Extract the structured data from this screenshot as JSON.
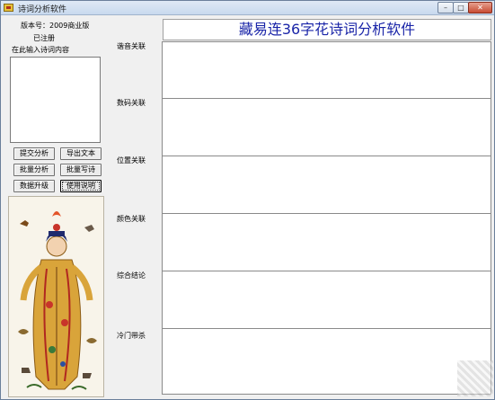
{
  "window": {
    "title": "诗词分析软件",
    "controls": {
      "minimize": "–",
      "maximize": "□",
      "close": "✕"
    }
  },
  "left_panel": {
    "version": "版本号：2009商业版",
    "registration_status": "已注册",
    "input_label": "在此输入诗词内容",
    "poem_input": {
      "value": "",
      "placeholder": ""
    },
    "buttons": {
      "submit_analysis": "提交分析",
      "export_text": "导出文本",
      "batch_analysis": "批量分析",
      "batch_write": "批量写诗",
      "data_upgrade": "数据升级",
      "instructions": "使用说明"
    }
  },
  "main": {
    "banner_title": "藏易连36字花诗词分析软件",
    "sections": [
      {
        "label": "谐音关联",
        "value": ""
      },
      {
        "label": "数码关联",
        "value": ""
      },
      {
        "label": "位置关联",
        "value": ""
      },
      {
        "label": "颜色关联",
        "value": ""
      },
      {
        "label": "综合结论",
        "value": ""
      },
      {
        "label": "冷门带杀",
        "value": ""
      }
    ]
  },
  "colors": {
    "banner_text": "#1a25a8",
    "window_bg": "#f0f0f0",
    "result_bg": "#ffffff"
  }
}
